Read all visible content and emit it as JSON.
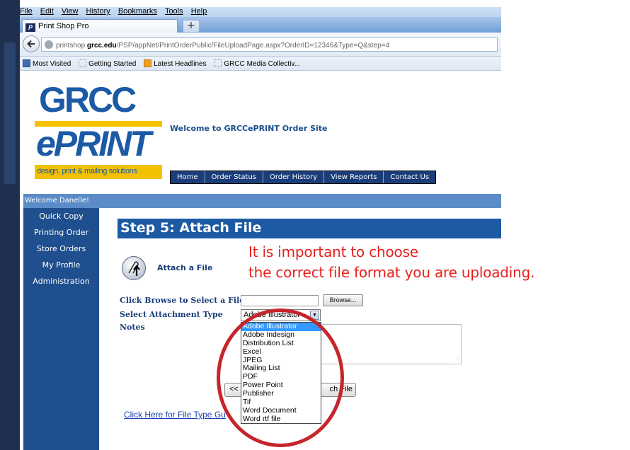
{
  "browser": {
    "menu": [
      "File",
      "Edit",
      "View",
      "History",
      "Bookmarks",
      "Tools",
      "Help"
    ],
    "tab_title": "Print Shop Pro",
    "tab_favicon": "P",
    "new_tab_label": "+",
    "url_prefix": "printshop.",
    "url_domain": "grcc.edu",
    "url_path": "/PSP/appNet/PrintOrderPublic/FileUploadPage.aspx?OrderID=12346&Type=Q&step=4",
    "bookmarks": [
      "Most Visited",
      "Getting Started",
      "Latest Headlines",
      "GRCC Media Collectiv..."
    ]
  },
  "logo": {
    "line1": "GRCC",
    "line2": "ePRINT",
    "tagline": "design, print & mailing solutions"
  },
  "header": {
    "welcome_site": "Welcome to GRCCePRINT Order Site",
    "nav": [
      "Home",
      "Order Status",
      "Order History",
      "View Reports",
      "Contact Us"
    ]
  },
  "user_bar": "Welcome Danelle!",
  "sidebar": [
    "Quick Copy",
    "Printing Order",
    "Store Orders",
    "My Profile",
    "Administration"
  ],
  "step": {
    "word": "Step",
    "title": "5: Attach File"
  },
  "attach": {
    "label": "Attach a File"
  },
  "form": {
    "browse_label": "Click Browse to Select a File",
    "browse_button": "Browse...",
    "type_label": "Select Attachment Type",
    "type_selected": "Adobe Illustrator",
    "notes_label": "Notes",
    "back_button": "<<",
    "attach_button": "ch File",
    "guide_link": "Click Here for File Type Gu"
  },
  "type_options": [
    "Adobe Illustrator",
    "Adobe Indesign",
    "Distribution List",
    "Excel",
    "JPEG",
    "Mailing List",
    "PDF",
    "Power Point",
    "Publisher",
    "Tif",
    "Word Document",
    "Word rtf file"
  ],
  "annotation": {
    "line1": "It is important to choose",
    "line2": "the correct file  format you are uploading.",
    "color": "#e8201c"
  },
  "colors": {
    "brand_blue": "#1c5aa6",
    "brand_yellow": "#f2c200",
    "nav_bg": "#1b3e7a",
    "sidebar_bg": "#1f4f8e",
    "select_highlight": "#3399ff"
  }
}
